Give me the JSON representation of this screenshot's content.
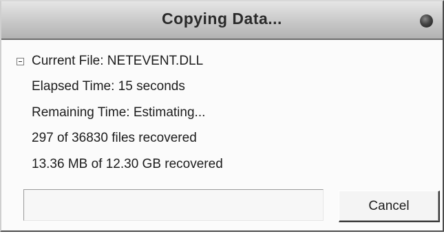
{
  "window": {
    "title": "Copying Data..."
  },
  "status": {
    "current_file": "Current File: NETEVENT.DLL",
    "elapsed_time": "Elapsed Time: 15 seconds",
    "remaining_time": "Remaining Time: Estimating...",
    "files_recovered": "297 of 36830 files recovered",
    "bytes_recovered": "13.36 MB of 12.30 GB recovered"
  },
  "progress": {
    "fraction": 0.0
  },
  "buttons": {
    "cancel_label": "Cancel"
  },
  "icons": {
    "title_indicator": "window-control-dot-icon",
    "expand_toggle": "collapse-minus-icon"
  },
  "colors": {
    "titlebar": "#c8c8c8",
    "background": "#fbfbfb",
    "progress_fill": "#3a6fb0"
  }
}
